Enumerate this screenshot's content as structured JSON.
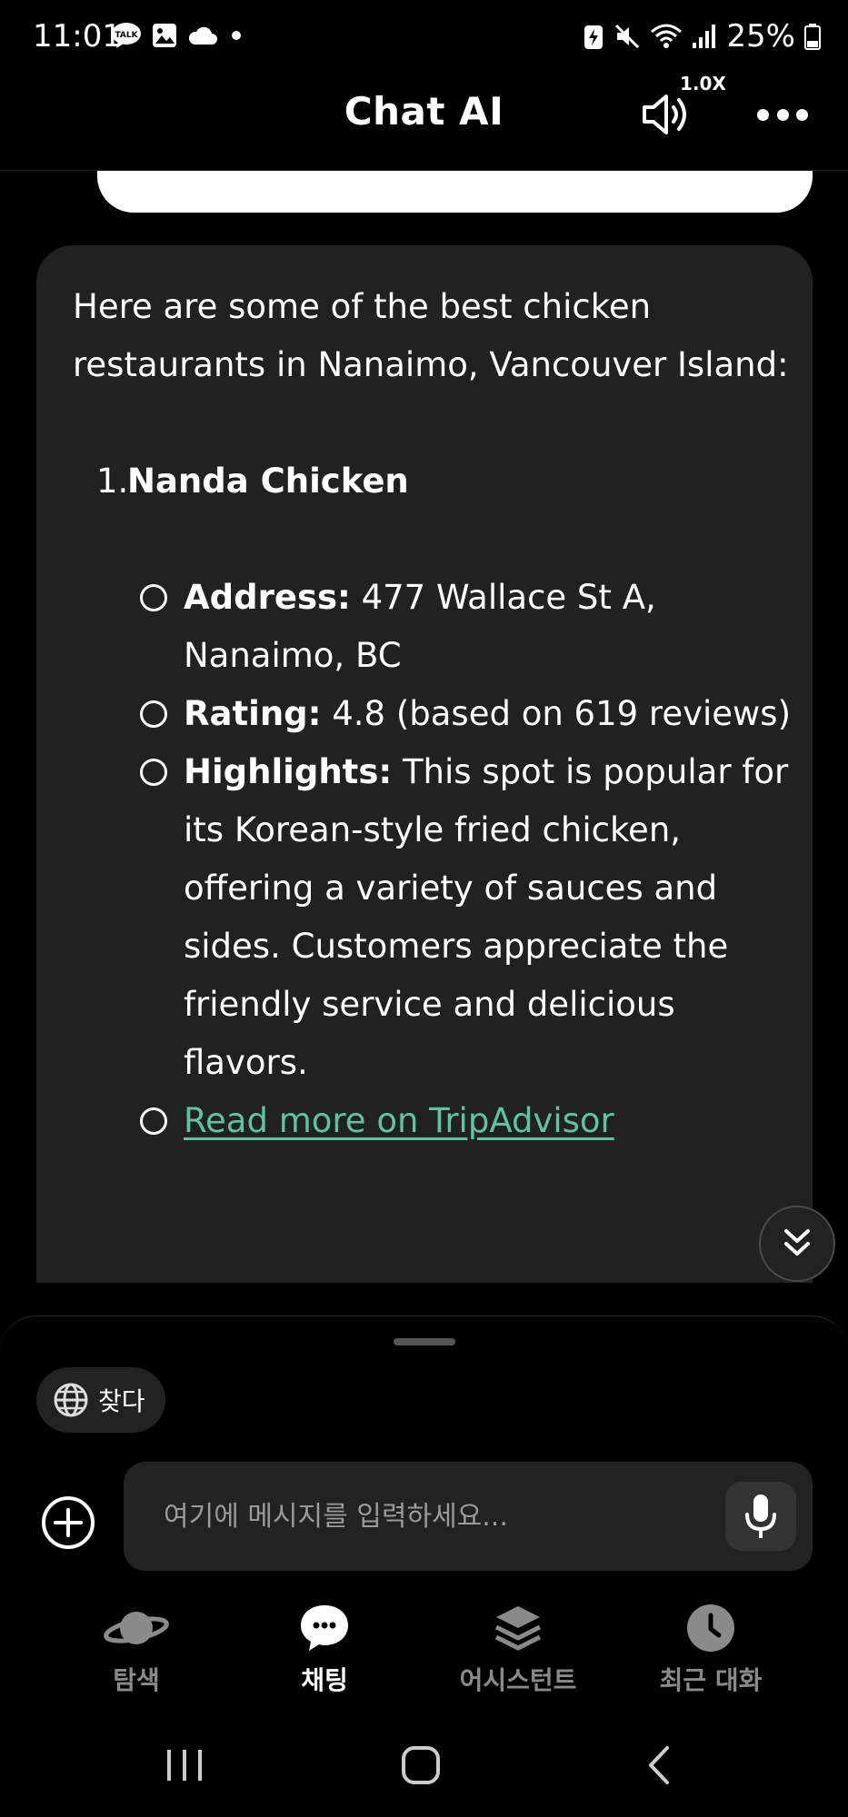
{
  "status_bar": {
    "time": "11:01",
    "battery": "25%"
  },
  "header": {
    "title": "Chat AI",
    "speed": "1.0X"
  },
  "message": {
    "intro": "Here are some of the best chicken restaurants in Nanaimo, Vancouver Island:",
    "restaurants": [
      {
        "number": "1.",
        "name": "Nanda Chicken",
        "address_label": "Address:",
        "address": "477 Wallace St A, Nanaimo, BC",
        "rating_label": "Rating:",
        "rating": "4.8 (based on 619 reviews)",
        "highlights_label": "Highlights:",
        "highlights": "This spot is popular for its Korean-style fried chicken, offering a variety of sauces and sides. Customers appreciate the friendly service and delicious flavors.",
        "link": "Read more on TripAdvisor"
      }
    ]
  },
  "composer": {
    "search_chip": "찾다",
    "placeholder": "여기에 메시지를 입력하세요..."
  },
  "nav": {
    "explore": "탐색",
    "chat": "채팅",
    "assistant": "어시스턴트",
    "recent": "최근 대화"
  },
  "colors": {
    "link": "#5ec4a0",
    "bubble": "#212121",
    "background": "#000000"
  }
}
